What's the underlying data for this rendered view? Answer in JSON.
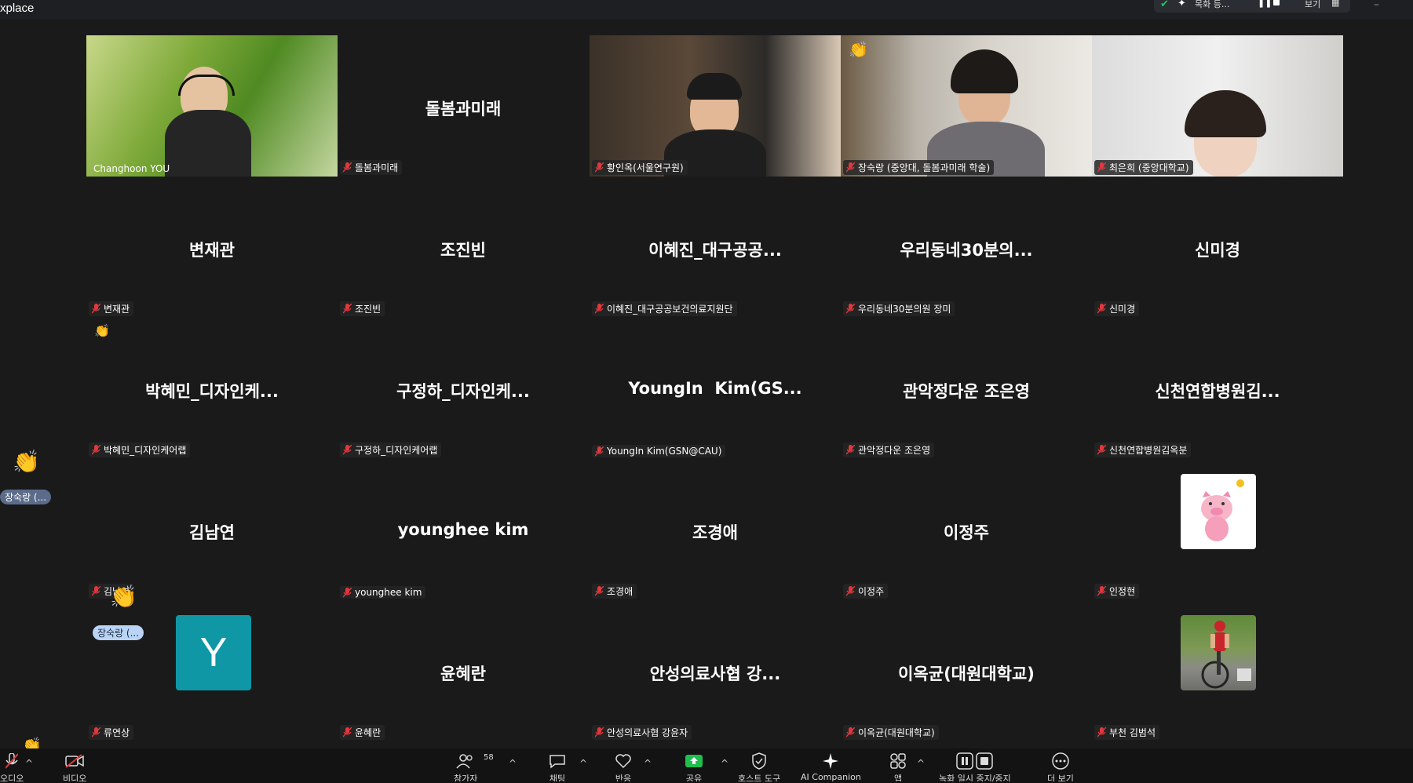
{
  "app": {
    "title": "xplace"
  },
  "topbar": {
    "right_text": "목화 등...",
    "view_label": "보기"
  },
  "tiles": [
    {
      "id": "changhoon",
      "name": "Changhoon YOU",
      "big": ""
    },
    {
      "id": "dolbom",
      "name": "돌봄과미래",
      "big": "돌봄과미래"
    },
    {
      "id": "hwang",
      "name": "황인옥(서울연구원)",
      "big": ""
    },
    {
      "id": "jang",
      "name": "장숙랑 (중앙대, 돌봄과미래 학술)",
      "big": ""
    },
    {
      "id": "choi",
      "name": "최은희 (중앙대학교)",
      "big": ""
    },
    {
      "id": "byeon",
      "name": "변재관",
      "big": "변재관"
    },
    {
      "id": "cho",
      "name": "조진빈",
      "big": "조진빈"
    },
    {
      "id": "lee_hj",
      "name": "이혜진_대구공공보건의료지원단",
      "big": "이혜진_대구공공..."
    },
    {
      "id": "woori",
      "name": "우리동네30분의원 장미",
      "big": "우리동네30분의..."
    },
    {
      "id": "shin",
      "name": "신미경",
      "big": "신미경"
    },
    {
      "id": "park",
      "name": "박혜민_디자인케어랩",
      "big": "박혜민_디자인케..."
    },
    {
      "id": "koo",
      "name": "구정하_디자인케어랩",
      "big": "구정하_디자인케..."
    },
    {
      "id": "younginkim",
      "name": "YoungIn Kim(GSN@CAU)",
      "big": "YoungIn  Kim(GS..."
    },
    {
      "id": "gwanak",
      "name": "관악정다운 조은영",
      "big": "관악정다운 조은영"
    },
    {
      "id": "sinchon",
      "name": "신천연합병원김옥분",
      "big": "신천연합병원김..."
    },
    {
      "id": "kimny",
      "name": "김남연",
      "big": "김남연"
    },
    {
      "id": "younghee",
      "name": "younghee kim",
      "big": "younghee kim"
    },
    {
      "id": "chogy",
      "name": "조경애",
      "big": "조경애"
    },
    {
      "id": "leejj",
      "name": "이정주",
      "big": "이정주"
    },
    {
      "id": "injh",
      "name": "인정현",
      "big": ""
    },
    {
      "id": "ryu",
      "name": "류연상",
      "big": ""
    },
    {
      "id": "yoon",
      "name": "윤혜란",
      "big": "윤혜란"
    },
    {
      "id": "anseong",
      "name": "안성의료사협 강윤자",
      "big": "안성의료사협 강..."
    },
    {
      "id": "leeok",
      "name": "이옥균(대원대학교)",
      "big": "이옥균(대원대학교)"
    },
    {
      "id": "bucheon",
      "name": "부천 김범석",
      "big": ""
    }
  ],
  "avatar_letter": "Y",
  "side_pills": {
    "pill1": "장숙랑 (...",
    "pill2": "장숙랑 (..."
  },
  "toolbar": {
    "audio_label": "오디오",
    "video_label": "비디오",
    "participants_label": "참가자",
    "participants_count": "58",
    "chat_label": "채팅",
    "react_label": "반응",
    "share_label": "공유",
    "host_tools_label": "호스트 도구",
    "ai_label": "AI Companion",
    "apps_label": "앱",
    "pause_label": "녹화 일시 중지/중지",
    "more_label": "더 보기"
  },
  "colors": {
    "active_border": "#22d36b",
    "avatar_teal": "#0f97a6",
    "share_green": "#1fbf4f",
    "muted_red": "#e0383e"
  }
}
